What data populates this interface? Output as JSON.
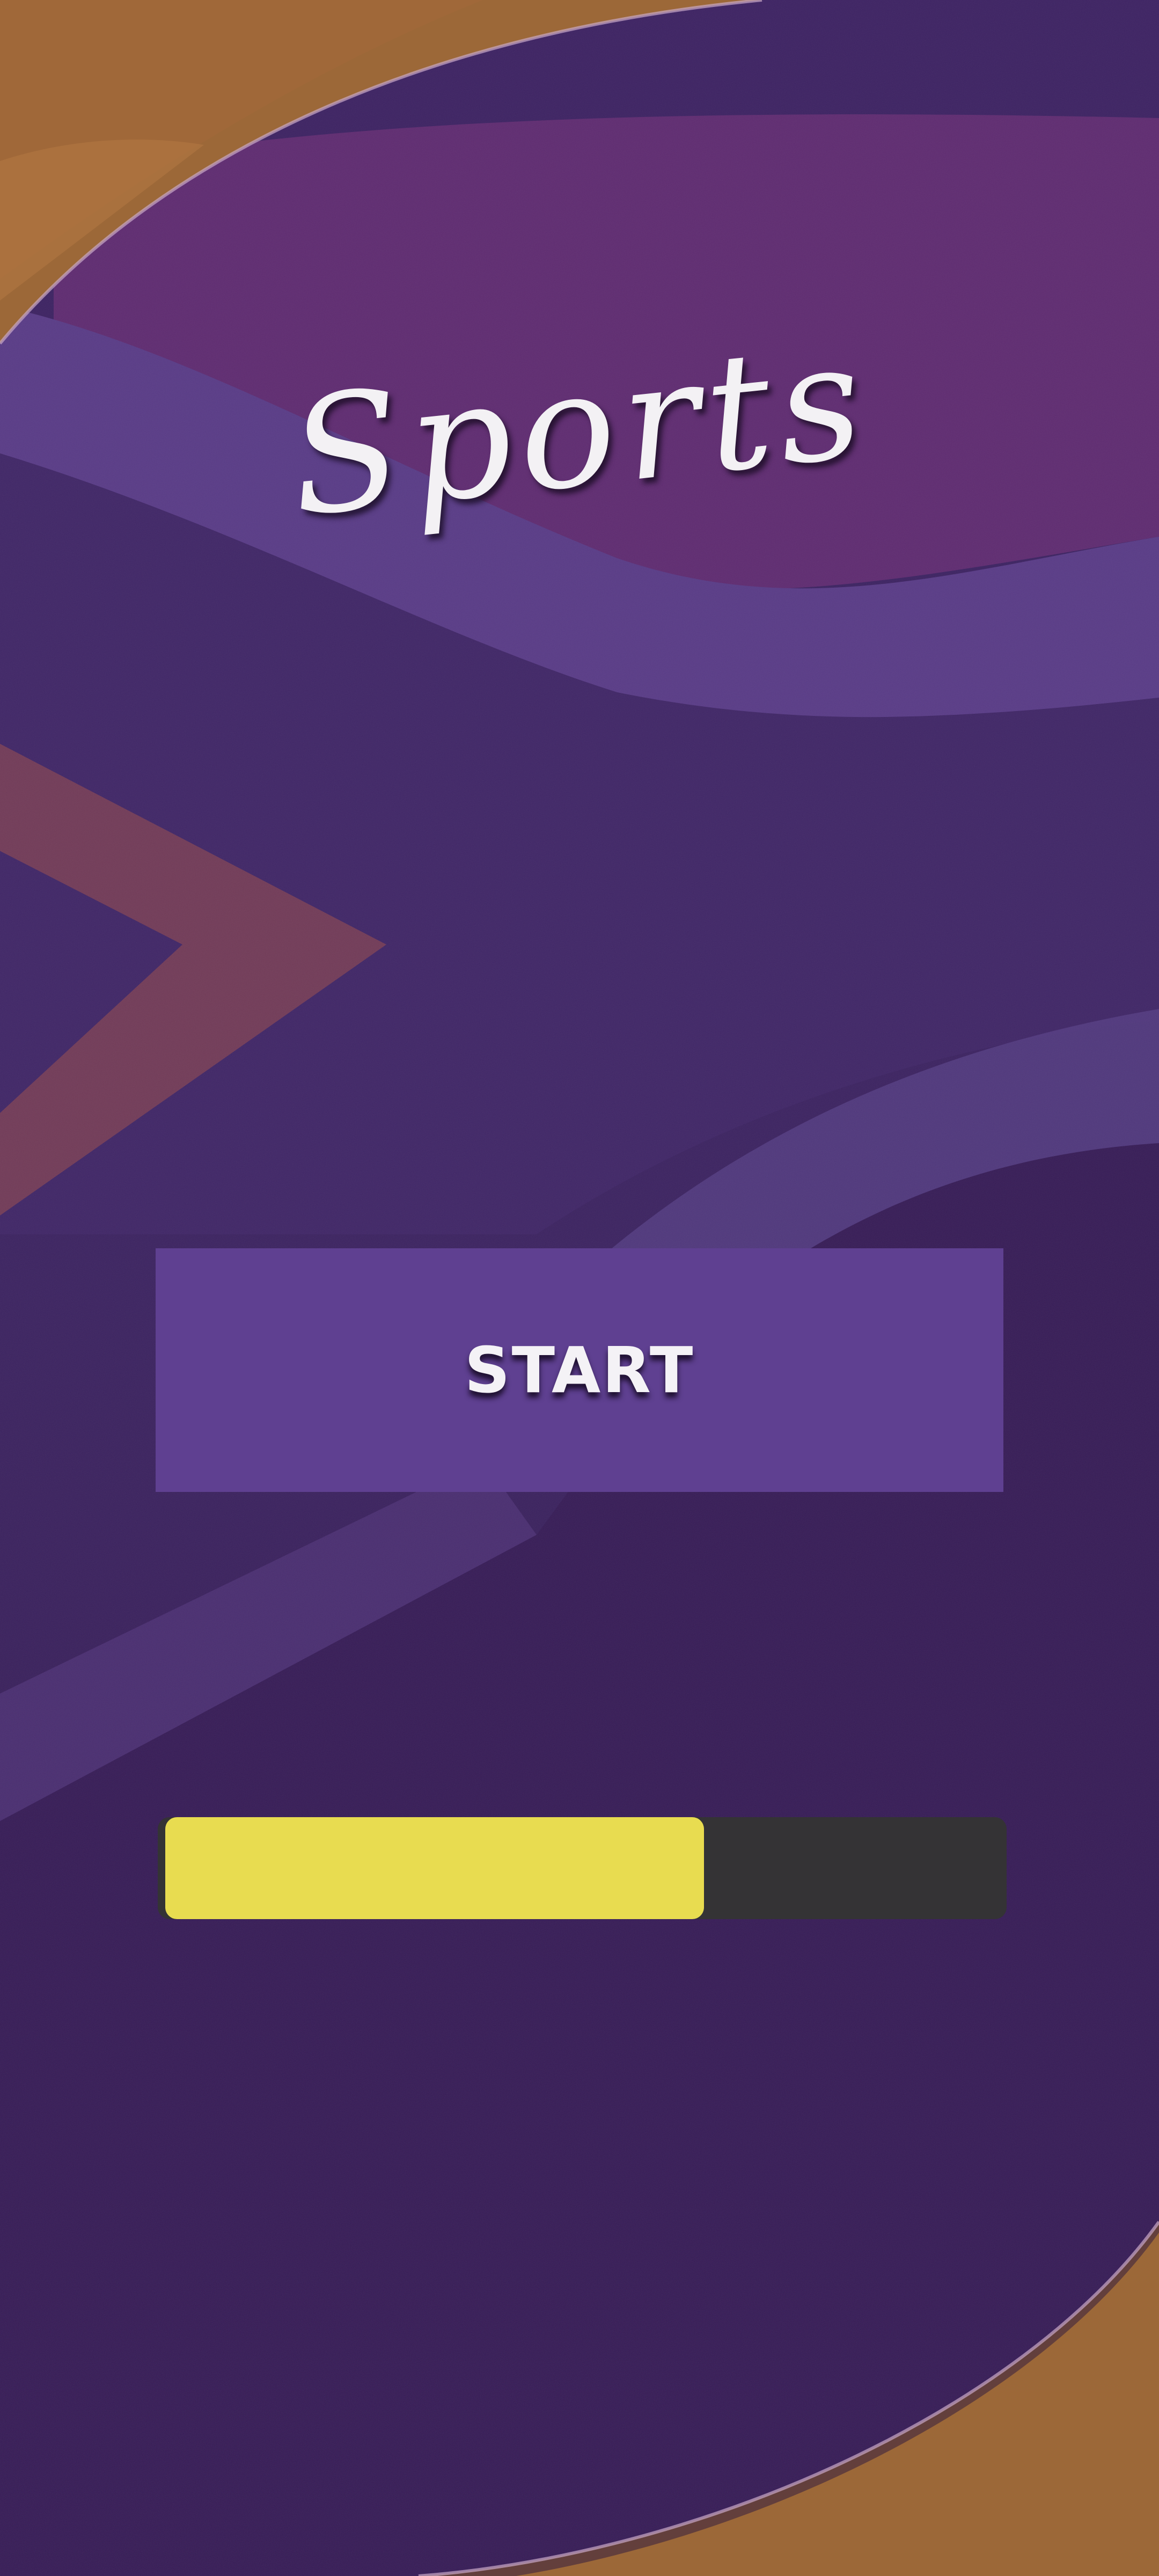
{
  "title": "Sports",
  "start_button": {
    "label": "START"
  },
  "progress": {
    "fraction": 0.64
  },
  "colors": {
    "background_orange": "#9a6a3a",
    "panel_purple": "#3a1d5a",
    "button_purple": "#5f4091",
    "progress_fill": "#e8dc50",
    "progress_track": "#343335",
    "title_text": "#f3f1f4"
  }
}
